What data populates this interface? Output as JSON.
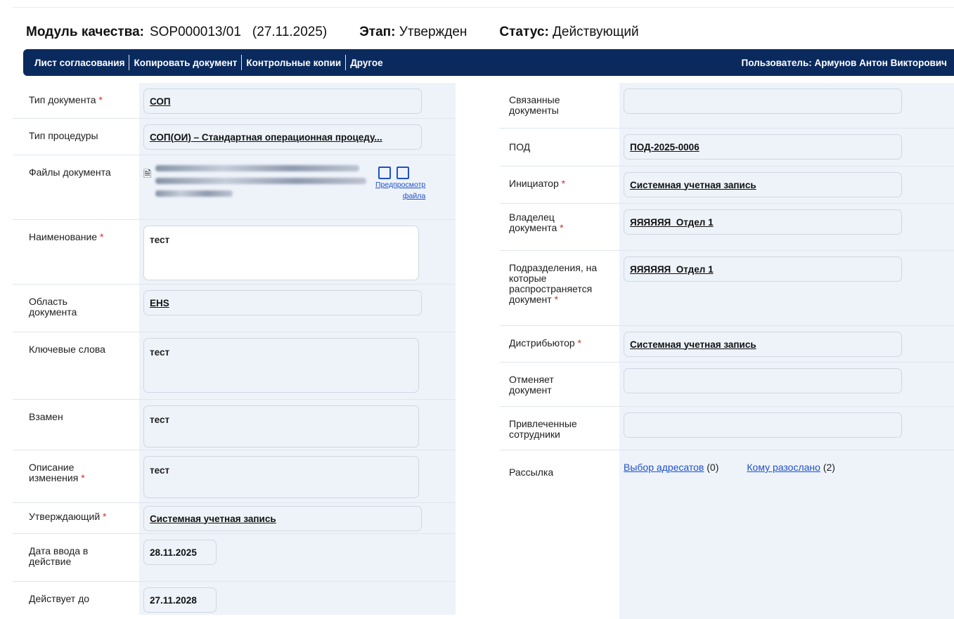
{
  "header": {
    "module_label": "Модуль качества:",
    "module_value": "SOP000013/01",
    "module_date": "(27.11.2025)",
    "stage_label": "Этап:",
    "stage_value": "Утвержден",
    "status_label": "Статус:",
    "status_value": "Действующий"
  },
  "toolbar": {
    "items": [
      "Лист согласования",
      "Копировать документ",
      "Контрольные копии",
      "Другое"
    ],
    "user": "Пользователь: Армунов Антон Викторович"
  },
  "left": {
    "doc_type": {
      "label": "Тип документа",
      "value": "СОП"
    },
    "proc_type": {
      "label": "Тип процедуры",
      "value": "СОП(ОИ) – Стандартная операционная процеду..."
    },
    "files": {
      "label": "Файлы документа",
      "preview_1": "Предпросмотр",
      "preview_2": "файла"
    },
    "name": {
      "label": "Наименование",
      "value": "тест"
    },
    "area": {
      "label_1": "Область",
      "label_2": "документа",
      "value": "EHS"
    },
    "keywords": {
      "label": "Ключевые слова",
      "value": "тест"
    },
    "instead": {
      "label": "Взамен",
      "value": "тест"
    },
    "change_desc": {
      "label_1": "Описание",
      "label_2": "изменения",
      "value": "тест"
    },
    "approver": {
      "label": "Утверждающий",
      "value": "Системная учетная запись"
    },
    "effective": {
      "label_1": "Дата ввода в",
      "label_2": "действие",
      "value": "28.11.2025"
    },
    "valid_until": {
      "label": "Действует до",
      "value": "27.11.2028"
    }
  },
  "right": {
    "related": {
      "label_1": "Связанные",
      "label_2": "документы",
      "value": ""
    },
    "pod": {
      "label": "ПОД",
      "value": "ПОД-2025-0006"
    },
    "initiator": {
      "label": "Инициатор",
      "value": "Системная учетная запись"
    },
    "owner": {
      "label_1": "Владелец",
      "label_2": "документа",
      "value": "ЯЯЯЯЯЯ_Отдел 1"
    },
    "divisions": {
      "label_1": "Подразделения, на",
      "label_2": "которые",
      "label_3": "распространяется",
      "label_4": "документ",
      "value": "ЯЯЯЯЯЯ_Отдел 1"
    },
    "distributor": {
      "label": "Дистрибьютор",
      "value": "Системная учетная запись"
    },
    "cancels": {
      "label_1": "Отменяет",
      "label_2": "документ",
      "value": ""
    },
    "involved": {
      "label_1": "Привлеченные",
      "label_2": "сотрудники",
      "value": ""
    },
    "mailing": {
      "label": "Рассылка",
      "choose": "Выбор адресатов",
      "choose_count": "(0)",
      "sent": "Кому разослано",
      "sent_count": "(2)"
    }
  },
  "required_mark": "*"
}
